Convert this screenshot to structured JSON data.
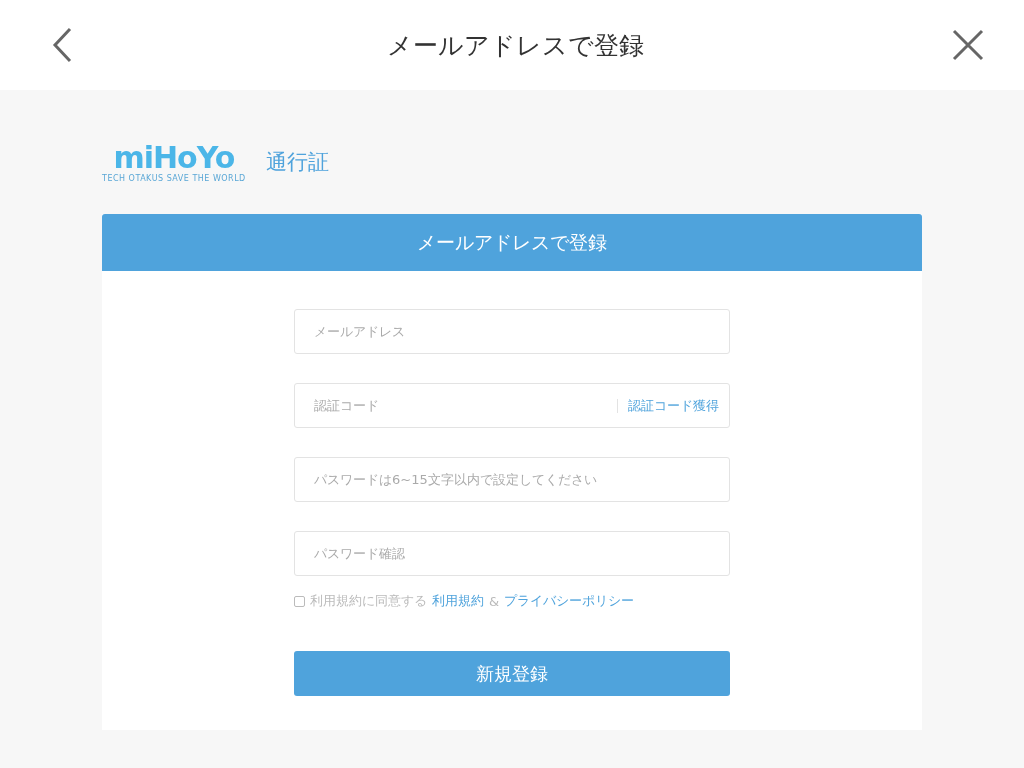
{
  "header": {
    "title": "メールアドレスで登録"
  },
  "logo": {
    "wordmark": "miHoYo",
    "tagline": "TECH OTAKUS SAVE THE WORLD",
    "service": "通行証"
  },
  "card": {
    "title": "メールアドレスで登録",
    "fields": [
      {
        "placeholder": "メールアドレス"
      },
      {
        "placeholder": "認証コード",
        "action": "認証コード獲得"
      },
      {
        "placeholder": "パスワードは6~15文字以内で設定してください"
      },
      {
        "placeholder": "パスワード確認"
      }
    ],
    "agreement": {
      "checked": false,
      "text": "利用規約に同意する",
      "link1": "利用規約",
      "separator": "&",
      "link2": "プライバシーポリシー"
    },
    "submit": "新規登録"
  }
}
